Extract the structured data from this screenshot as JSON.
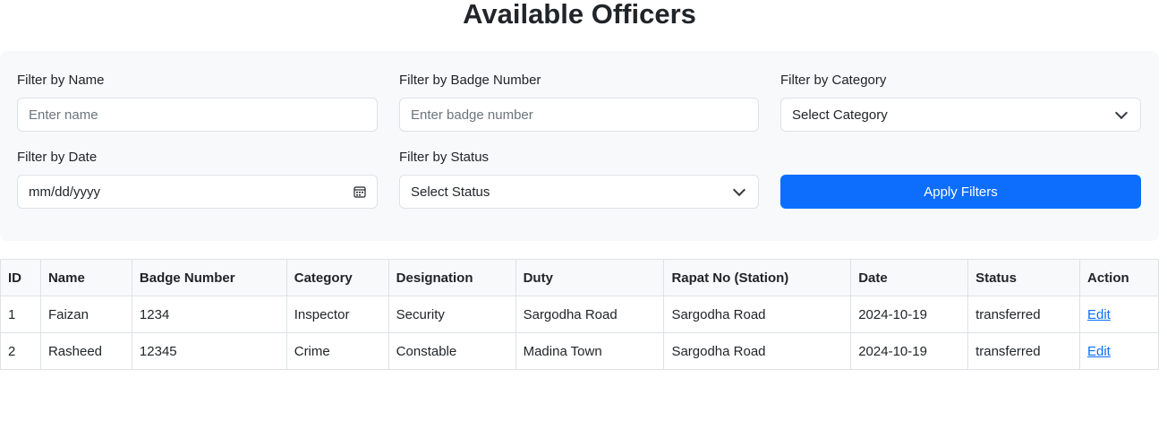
{
  "page": {
    "title": "Available Officers"
  },
  "filters": {
    "name": {
      "label": "Filter by Name",
      "placeholder": "Enter name"
    },
    "badge": {
      "label": "Filter by Badge Number",
      "placeholder": "Enter badge number"
    },
    "category": {
      "label": "Filter by Category",
      "selected": "Select Category"
    },
    "date": {
      "label": "Filter by Date",
      "placeholder": "mm/dd/yyyy"
    },
    "status": {
      "label": "Filter by Status",
      "selected": "Select Status"
    },
    "apply_label": "Apply Filters"
  },
  "table": {
    "columns": [
      "ID",
      "Name",
      "Badge Number",
      "Category",
      "Designation",
      "Duty",
      "Rapat No (Station)",
      "Date",
      "Status",
      "Action"
    ],
    "rows": [
      {
        "id": "1",
        "name": "Faizan",
        "badge": "1234",
        "category": "Inspector",
        "designation": "Security",
        "duty": "Sargodha Road",
        "rapat": "Sargodha Road",
        "date": "2024-10-19",
        "status": "transferred",
        "action": "Edit"
      },
      {
        "id": "2",
        "name": "Rasheed",
        "badge": "12345",
        "category": "Crime",
        "designation": "Constable",
        "duty": "Madina Town",
        "rapat": "Sargodha Road",
        "date": "2024-10-19",
        "status": "transferred",
        "action": "Edit"
      }
    ]
  },
  "colors": {
    "primary": "#0d6efd",
    "panel_bg": "#f8f9fa",
    "border": "#dee2e6",
    "text": "#212529",
    "placeholder": "#6c757d"
  },
  "icons": {
    "date": "calendar-icon",
    "select": "chevron-down-icon"
  }
}
